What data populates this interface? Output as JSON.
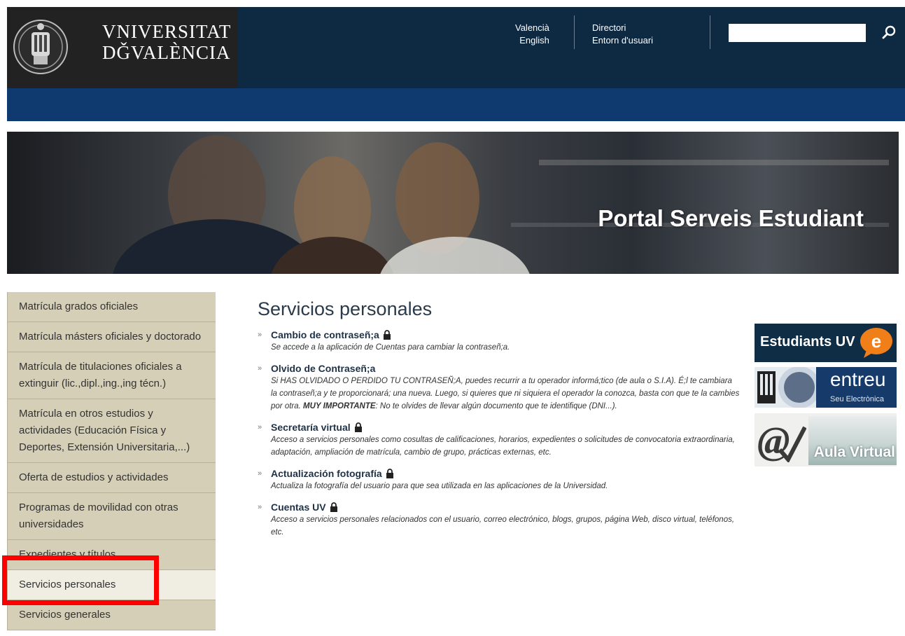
{
  "header": {
    "university_name_line1": "VNIVERSITAT",
    "university_name_line2": "DǦVALÈNCIA",
    "lang_links": [
      "Valencià",
      "English"
    ],
    "user_links": [
      "Directori",
      "Entorn d'usuari"
    ],
    "search": {
      "value": "",
      "placeholder": ""
    }
  },
  "banner": {
    "title": "Portal Serveis Estudiant"
  },
  "sidebar": {
    "items": [
      {
        "label": "Matrícula grados oficiales"
      },
      {
        "label": "Matrícula másters oficiales y doctorado"
      },
      {
        "label": "Matrícula de titulaciones oficiales a extinguir (lic.,dipl.,ing.,ing técn.)"
      },
      {
        "label": "Matrícula en otros estudios y actividades (Educación Física y Deportes, Extensión Universitaria,...)"
      },
      {
        "label": "Oferta de estudios y actividades"
      },
      {
        "label": "Programas de movilidad con otras universidades"
      },
      {
        "label": "Expedientes y títulos"
      },
      {
        "label": "Servicios personales",
        "active": true
      },
      {
        "label": "Servicios generales"
      }
    ]
  },
  "main": {
    "title": "Servicios personales",
    "services": [
      {
        "title": "Cambio de contraseñ;a",
        "locked": true,
        "desc": "Se accede a la aplicación de Cuentas para cambiar la contraseñ;a."
      },
      {
        "title": "Olvido de Contraseñ;a",
        "locked": false,
        "desc": "Si HAS OLVIDADO O PERDIDO TU CONTRASEÑ;A, puedes recurrir a tu operador informá;tico (de aula o S.I.A). É;l te cambiara la contraseñ;a y te proporcionará; una nueva. Luego, si quieres que ni siquiera el operador la conozca, basta con que te la cambies por otra.",
        "desc_bold": "MUY IMPORTANTE",
        "desc_tail": ": No te olvides de llevar algún documento que te identifique (DNI...)."
      },
      {
        "title": "Secretaría virtual",
        "locked": true,
        "desc": "Acceso a servicios personales como cosultas de calificaciones, horarios, expedientes o solicitudes de convocatoria extraordinaria, adaptación, ampliación de matrícula, cambio de grupo, prácticas externas, etc."
      },
      {
        "title": "Actualización fotografía",
        "locked": true,
        "desc": "Actualiza la fotografía del usuario para que sea utilizada en las aplicaciones de la Universidad."
      },
      {
        "title": "Cuentas UV",
        "locked": true,
        "desc": "Acceso a servicios personales relacionados con el usuario, correo electrónico, blogs, grupos, página Web, disco virtual, teléfonos, etc."
      }
    ]
  },
  "right_banners": {
    "estudiants": {
      "label": "Estudiants UV",
      "badge": "e"
    },
    "entreu": {
      "label": "entreu",
      "sub": "Seu Electrònica"
    },
    "aula": {
      "label": "Aula Virtual",
      "mark": "@"
    }
  },
  "colors": {
    "header_bg": "#0e2942",
    "blue_bar": "#0f3a70",
    "sidebar_bg": "#d5cfb7",
    "sidebar_active": "#f0ede2",
    "highlight": "#ff0000",
    "accent_orange": "#f07f1a"
  }
}
